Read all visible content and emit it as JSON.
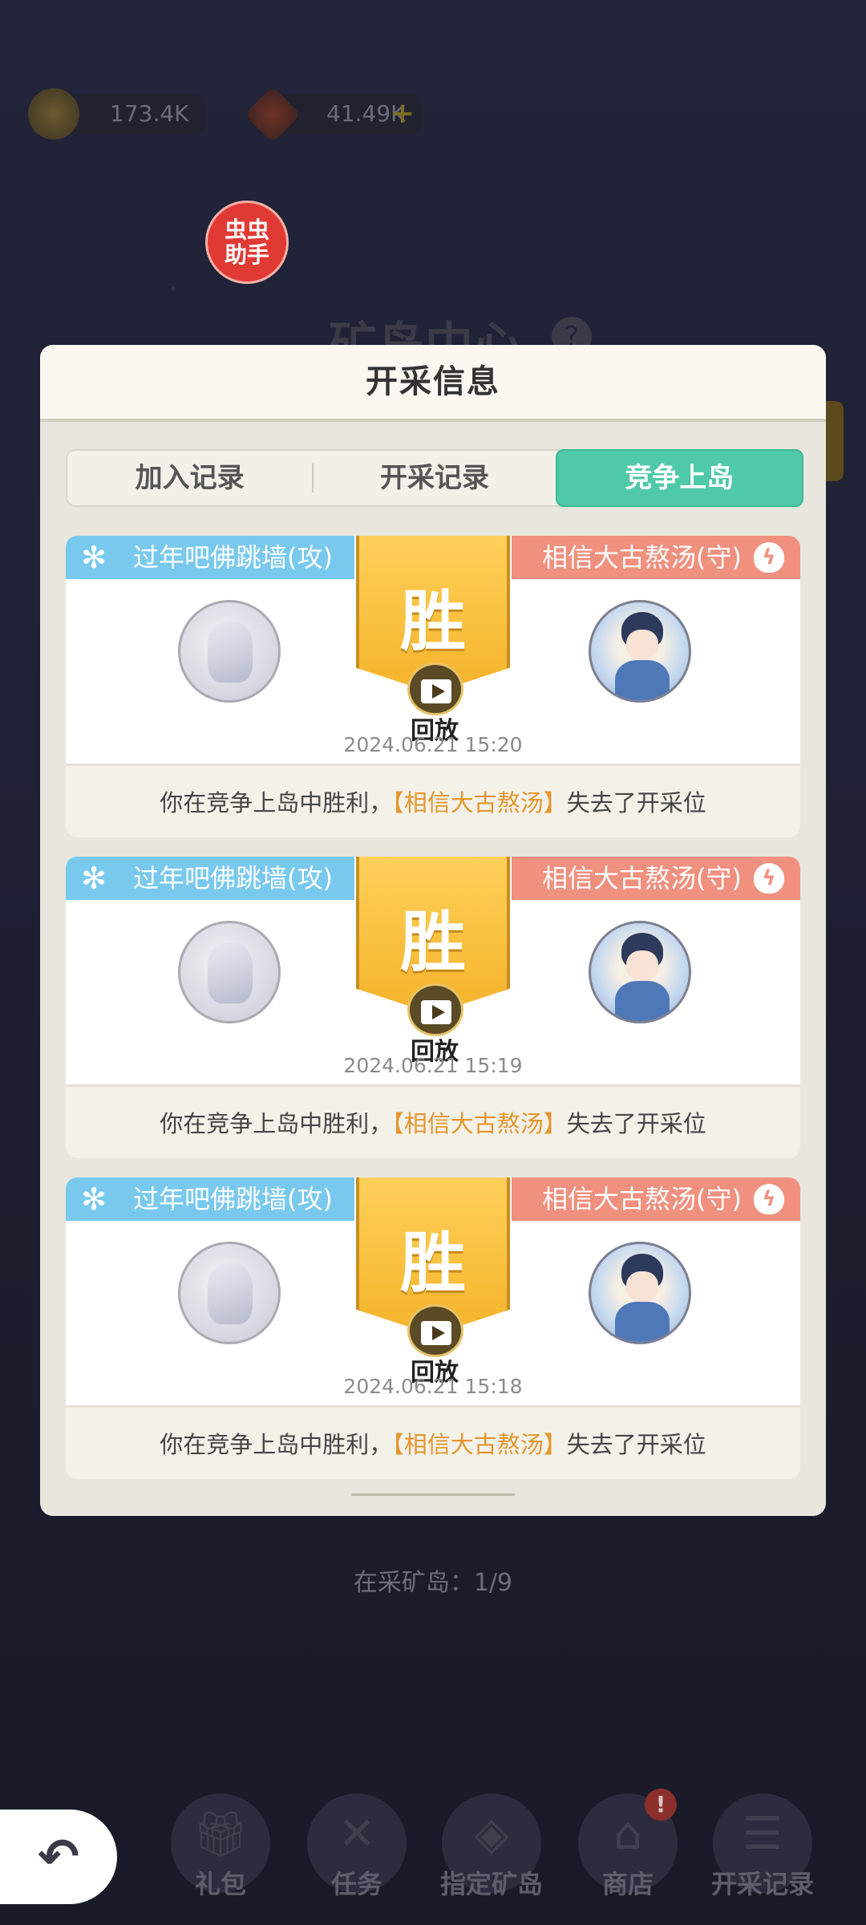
{
  "resources": {
    "coins": "173.4K",
    "gems": "41.49K",
    "plus": "+"
  },
  "helper": {
    "line1": "虫虫",
    "line2": "助手"
  },
  "background": {
    "title": "矿岛中心",
    "help": "?",
    "mining_status": "在采矿岛：1/9"
  },
  "modal": {
    "title": "开采信息",
    "tabs": [
      {
        "label": "加入记录"
      },
      {
        "label": "开采记录"
      },
      {
        "label": "竞争上岛"
      }
    ],
    "records": [
      {
        "attacker": "过年吧佛跳墙(攻)",
        "defender": "相信大古熬汤(守)",
        "result": "胜",
        "replay": "回放",
        "time": "2024.06.21 15:20",
        "msg_pre": "你在竞争上岛中胜利，",
        "msg_name": "【相信大古熬汤】",
        "msg_post": "失去了开采位"
      },
      {
        "attacker": "过年吧佛跳墙(攻)",
        "defender": "相信大古熬汤(守)",
        "result": "胜",
        "replay": "回放",
        "time": "2024.06.21 15:19",
        "msg_pre": "你在竞争上岛中胜利，",
        "msg_name": "【相信大古熬汤】",
        "msg_post": "失去了开采位"
      },
      {
        "attacker": "过年吧佛跳墙(攻)",
        "defender": "相信大古熬汤(守)",
        "result": "胜",
        "replay": "回放",
        "time": "2024.06.21 15:18",
        "msg_pre": "你在竞争上岛中胜利，",
        "msg_name": "【相信大古熬汤】",
        "msg_post": "失去了开采位"
      }
    ]
  },
  "nav": {
    "gift": "礼包",
    "task": "任务",
    "island": "指定矿岛",
    "shop": "商店",
    "shop_badge": "!",
    "records": "开采记录"
  },
  "icons": {
    "back": "back-arrow-icon",
    "attacker": "claw-icon",
    "defender": "shield-lightning-icon",
    "replay": "play-clapper-icon"
  }
}
